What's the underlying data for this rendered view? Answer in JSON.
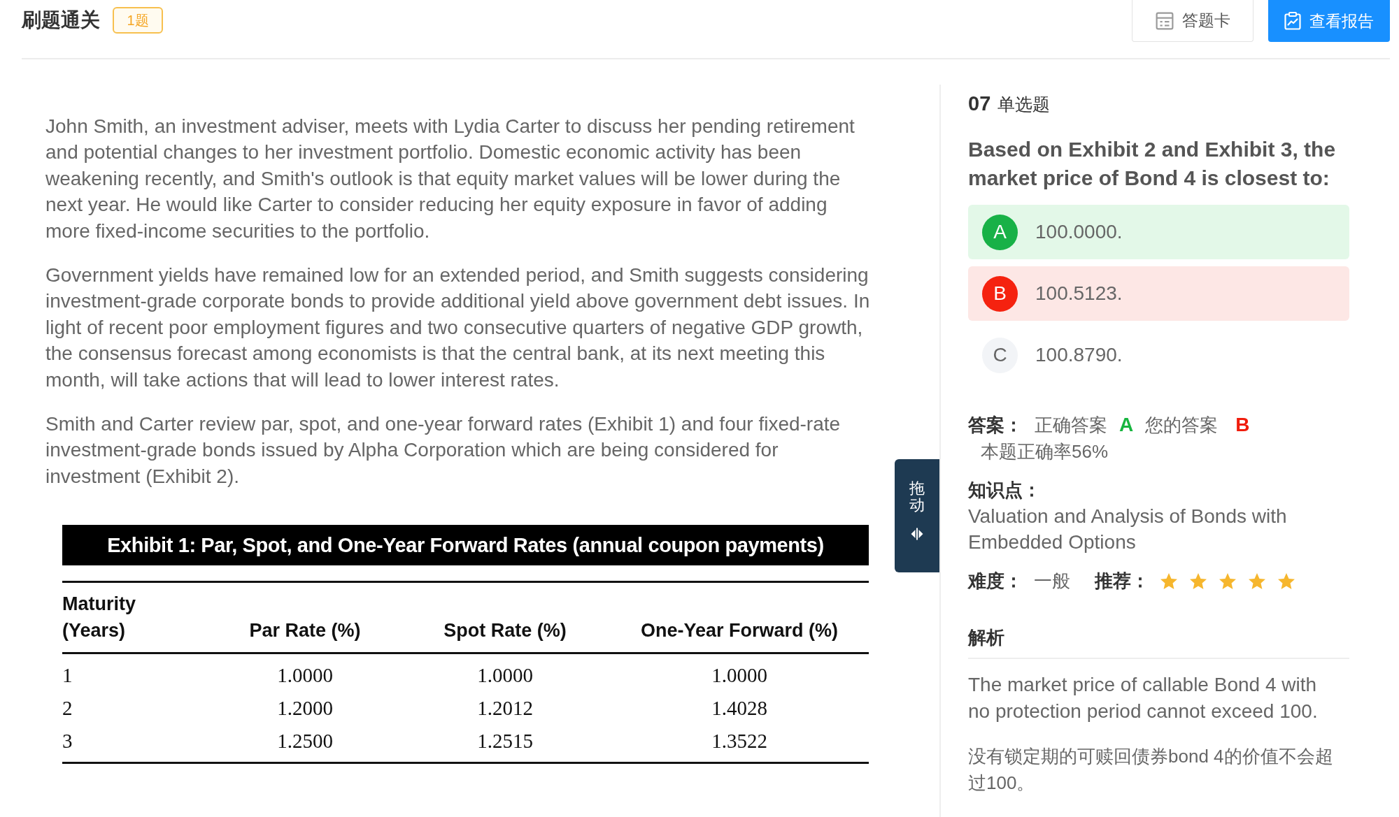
{
  "header": {
    "title": "刷题通关",
    "badge": "1题",
    "buttons": [
      {
        "kind": "outline",
        "label": "答题卡"
      },
      {
        "kind": "primary",
        "label": "查看报告"
      }
    ]
  },
  "passage": {
    "paragraphs": [
      "John Smith, an investment adviser, meets with Lydia Carter to discuss her pending retirement and potential changes to her investment portfolio. Domestic economic activity has been weakening recently, and Smith's outlook is that equity market values will be lower during the next year. He would like Carter to consider reducing her equity exposure in favor of adding more fixed-income securities to the portfolio.",
      "Government yields have remained low for an extended period, and Smith suggests considering investment-grade corporate bonds to provide additional yield above government debt issues. In light of recent poor employment figures and two consecutive quarters of negative GDP growth, the consensus forecast among economists is that the central bank, at its next meeting this month, will take actions that will lead to lower interest rates.",
      "Smith and Carter review par, spot, and one-year forward rates (Exhibit 1) and four fixed-rate investment-grade bonds issued by Alpha Corporation which are being considered for investment (Exhibit 2)."
    ],
    "exhibit": {
      "title": "Exhibit 1: Par, Spot, and One-Year Forward Rates (annual coupon payments)",
      "columns": [
        "Maturity (Years)",
        "Par Rate (%)",
        "Spot Rate (%)",
        "One-Year Forward (%)"
      ],
      "rows": [
        [
          "1",
          "1.0000",
          "1.0000",
          "1.0000"
        ],
        [
          "2",
          "1.2000",
          "1.2012",
          "1.4028"
        ],
        [
          "3",
          "1.2500",
          "1.2515",
          "1.3522"
        ]
      ]
    }
  },
  "drag_handle": {
    "label": "拖动"
  },
  "question": {
    "number": "07",
    "type": "单选题",
    "text": "Based on Exhibit 2 and Exhibit 3, the market price of Bond 4 is closest to:",
    "options": [
      {
        "letter": "A",
        "text": "100.0000.",
        "correct": true,
        "selected": false
      },
      {
        "letter": "B",
        "text": "100.5123.",
        "correct": false,
        "selected": true
      },
      {
        "letter": "C",
        "text": "100.8790.",
        "correct": false,
        "selected": false
      }
    ]
  },
  "answer": {
    "label": "答案：",
    "correct_label": "正确答案",
    "correct": "A",
    "yours_label": "您的答案",
    "yours": "B",
    "accuracy": "本题正确率56%"
  },
  "knowledge": {
    "label": "知识点：",
    "text": "Valuation and Analysis of Bonds with Embedded Options"
  },
  "difficulty": {
    "label": "难度：",
    "value": "一般"
  },
  "recommendation": {
    "label": "推荐：",
    "stars": 5
  },
  "analysis": {
    "title": "解析",
    "paragraphs": [
      "The market price of callable Bond 4 with no protection period cannot exceed 100.",
      "没有锁定期的可赎回债券bond 4的价值不会超过100。"
    ]
  }
}
